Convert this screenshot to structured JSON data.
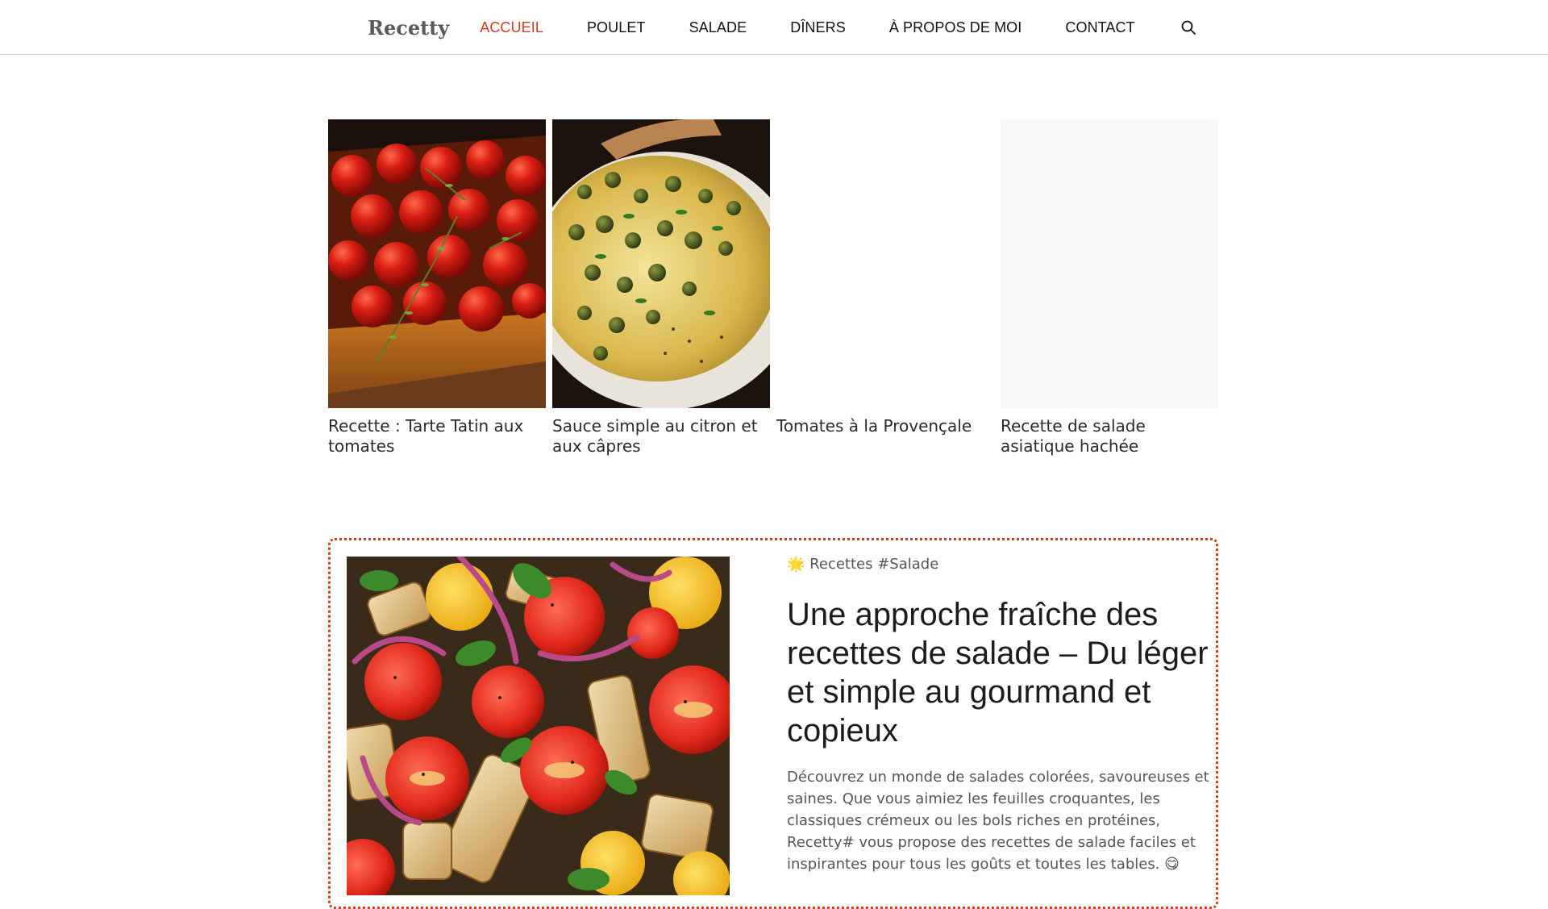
{
  "header": {
    "logo": "Recetty",
    "nav": [
      {
        "label": "ACCUEIL",
        "active": true
      },
      {
        "label": "POULET",
        "active": false
      },
      {
        "label": "SALADE",
        "active": false
      },
      {
        "label": "DÎNERS",
        "active": false
      },
      {
        "label": "À PROPOS DE MOI",
        "active": false
      },
      {
        "label": "CONTACT",
        "active": false
      }
    ],
    "search_icon": "search-icon"
  },
  "cards": [
    {
      "title": "Recette : Tarte Tatin aux tomates",
      "image": "tomato-tarte-tatin-photo"
    },
    {
      "title": "Sauce simple au citron et aux câpres",
      "image": "lemon-caper-sauce-photo"
    },
    {
      "title": "Tomates à la Provençale",
      "image": ""
    },
    {
      "title": "Recette de salade asiatique hachée",
      "image": ""
    }
  ],
  "featured": {
    "category_emoji": "🌟",
    "category_label": "Recettes",
    "category_tag": "#Salade",
    "title": "Une approche fraîche des recettes de salade – Du léger et simple au gourmand et copieux",
    "excerpt": "Découvrez un monde de salades colorées, savoureuses et saines. Que vous aimiez les feuilles croquantes, les classiques crémeux ou les bols riches en protéines, Recetty# vous propose des recettes de salade faciles et inspirantes pour tous les goûts et toutes les tables. 😋",
    "image": "panzanella-salad-photo"
  },
  "colors": {
    "accent": "#d2391b",
    "text": "#222222",
    "muted": "#555555",
    "border": "#d6d6d6"
  }
}
